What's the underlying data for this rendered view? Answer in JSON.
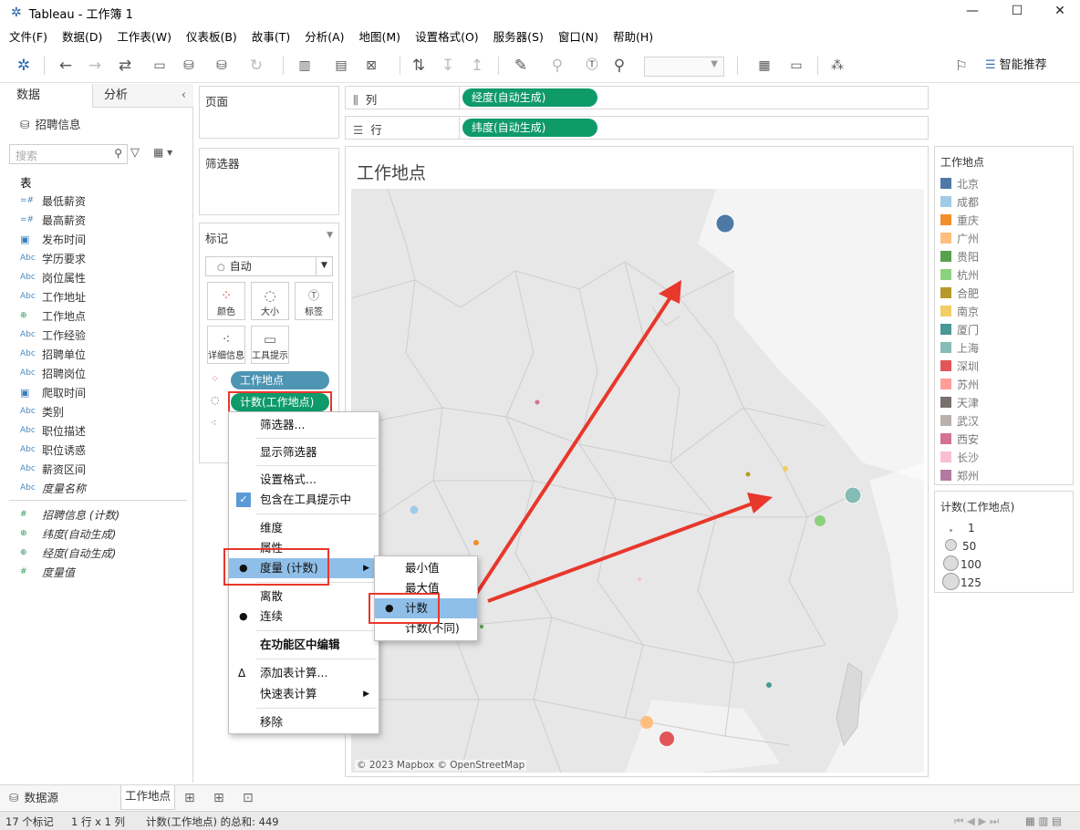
{
  "app": {
    "title": "Tableau - 工作簿 1",
    "icon": "tableau-logo-icon",
    "window_controls": [
      "—",
      "☐",
      "✕"
    ]
  },
  "menu": [
    "文件(F)",
    "数据(D)",
    "工作表(W)",
    "仪表板(B)",
    "故事(T)",
    "分析(A)",
    "地图(M)",
    "设置格式(O)",
    "服务器(S)",
    "窗口(N)",
    "帮助(H)"
  ],
  "toolbar": {
    "smart_label": "智能推荐"
  },
  "left_pane": {
    "tab_data": "数据",
    "tab_analysis": "分析",
    "datasource": "招聘信息",
    "search_placeholder": "搜索",
    "tables_heading": "表",
    "fields": [
      {
        "type": "#",
        "name": "最低薪资"
      },
      {
        "type": "#",
        "name": "最高薪资"
      },
      {
        "type": "date",
        "name": "发布时间"
      },
      {
        "type": "Abc",
        "name": "学历要求"
      },
      {
        "type": "Abc",
        "name": "岗位属性"
      },
      {
        "type": "Abc",
        "name": "工作地址"
      },
      {
        "type": "geo",
        "name": "工作地点"
      },
      {
        "type": "Abc",
        "name": "工作经验"
      },
      {
        "type": "Abc",
        "name": "招聘单位"
      },
      {
        "type": "Abc",
        "name": "招聘岗位"
      },
      {
        "type": "date",
        "name": "爬取时间"
      },
      {
        "type": "Abc",
        "name": "类别"
      },
      {
        "type": "Abc",
        "name": "职位描述"
      },
      {
        "type": "Abc",
        "name": "职位诱惑"
      },
      {
        "type": "Abc",
        "name": "薪资区间"
      },
      {
        "type": "Abc",
        "name": "度量名称"
      }
    ],
    "measures": [
      {
        "type": "#",
        "name": "招聘信息 (计数)"
      },
      {
        "type": "geo",
        "name": "纬度(自动生成)"
      },
      {
        "type": "geo",
        "name": "经度(自动生成)"
      },
      {
        "type": "#",
        "name": "度量值"
      }
    ]
  },
  "shelves": {
    "pages": "页面",
    "filters": "筛选器",
    "marks": "标记",
    "mark_type": "自动",
    "mark_buttons": [
      "颜色",
      "大小",
      "标签",
      "详细信息",
      "工具提示"
    ],
    "color_pill": "工作地点",
    "size_pill": "计数(工作地点)",
    "columns_label": "列",
    "rows_label": "行",
    "columns_pill": "经度(自动生成)",
    "rows_pill": "纬度(自动生成)"
  },
  "view": {
    "title": "工作地点",
    "attribution": "© 2023 Mapbox © OpenStreetMap"
  },
  "color_legend": {
    "title": "工作地点",
    "items": [
      {
        "name": "北京",
        "color": "#4e79a7"
      },
      {
        "name": "成都",
        "color": "#a0cbe8"
      },
      {
        "name": "重庆",
        "color": "#f28e2b"
      },
      {
        "name": "广州",
        "color": "#ffbe7d"
      },
      {
        "name": "贵阳",
        "color": "#59a14f"
      },
      {
        "name": "杭州",
        "color": "#8cd17d"
      },
      {
        "name": "合肥",
        "color": "#b6992d"
      },
      {
        "name": "南京",
        "color": "#f1ce63"
      },
      {
        "name": "厦门",
        "color": "#499894"
      },
      {
        "name": "上海",
        "color": "#86bcb6"
      },
      {
        "name": "深圳",
        "color": "#e15759"
      },
      {
        "name": "苏州",
        "color": "#ff9d9a"
      },
      {
        "name": "天津",
        "color": "#79706e"
      },
      {
        "name": "武汉",
        "color": "#bab0ac"
      },
      {
        "name": "西安",
        "color": "#d37295"
      },
      {
        "name": "长沙",
        "color": "#fabfd2"
      },
      {
        "name": "郑州",
        "color": "#b07aa1"
      }
    ]
  },
  "size_legend": {
    "title": "计数(工作地点)",
    "items": [
      "1",
      "50",
      "100",
      "125"
    ]
  },
  "context_menu": {
    "items": [
      "筛选器...",
      "显示筛选器",
      "设置格式...",
      "包含在工具提示中",
      "维度",
      "属性",
      "度量 (计数)",
      "离散",
      "连续",
      "在功能区中编辑",
      "添加表计算...",
      "快速表计算",
      "移除"
    ]
  },
  "submenu": {
    "items": [
      "最小值",
      "最大值",
      "计数",
      "计数(不同)"
    ]
  },
  "bottom": {
    "datasource_tab": "数据源",
    "sheet_tab": "工作地点"
  },
  "status": {
    "marks": "17 个标记",
    "dims": "1 行 x 1 列",
    "sum": "计数(工作地点) 的总和: 449"
  }
}
